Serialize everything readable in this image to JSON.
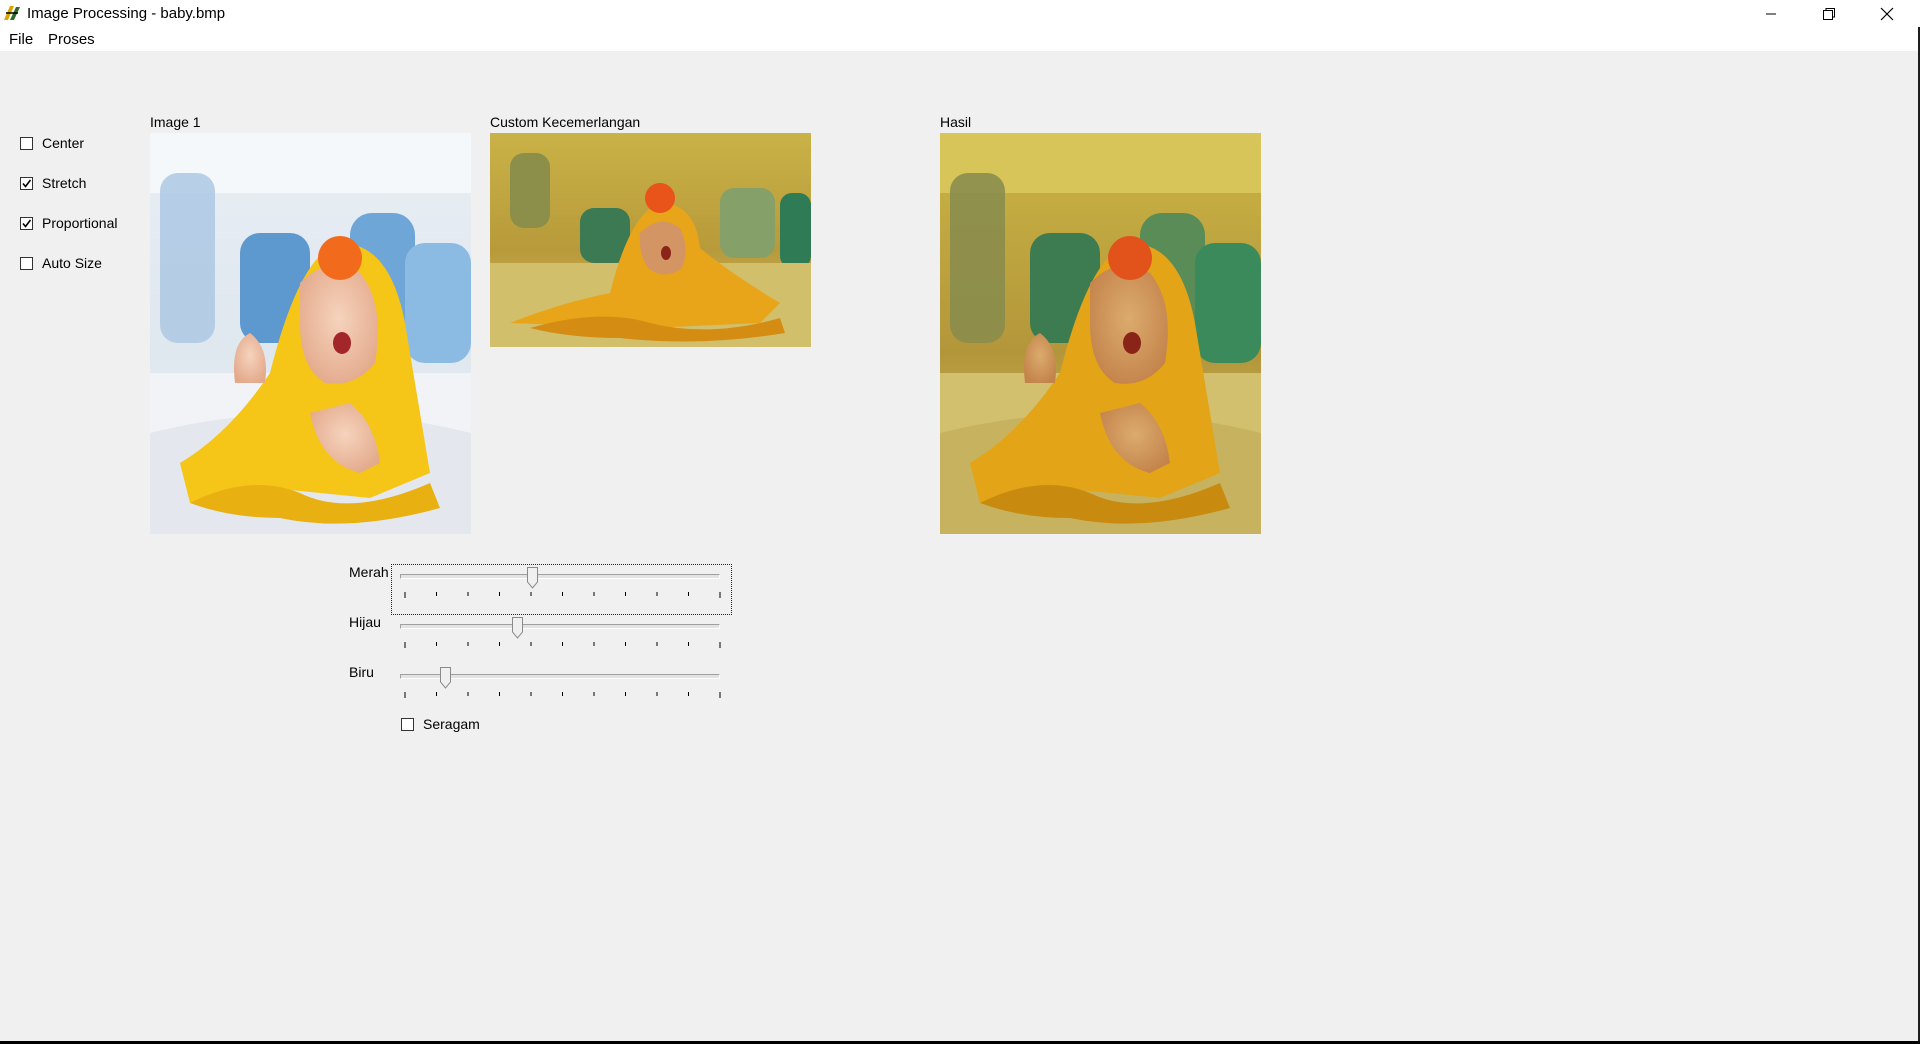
{
  "window": {
    "title": "Image Processing - baby.bmp",
    "icons": {
      "app": "app-icon",
      "minimize": "minimize-icon",
      "restore": "restore-icon",
      "close": "close-icon"
    }
  },
  "menu": {
    "items": [
      "File",
      "Proses"
    ]
  },
  "options": [
    {
      "label": "Center",
      "checked": false
    },
    {
      "label": "Stretch",
      "checked": true
    },
    {
      "label": "Proportional",
      "checked": true
    },
    {
      "label": "Auto Size",
      "checked": false
    }
  ],
  "panels": {
    "image1": {
      "caption": "Image 1"
    },
    "custom": {
      "caption": "Custom Kecemerlangan"
    },
    "result": {
      "caption": "Hasil"
    }
  },
  "sliders": [
    {
      "label": "Merah",
      "value": 0.41
    },
    {
      "label": "Hijau",
      "value": 0.36
    },
    {
      "label": "Biru",
      "value": 0.13
    }
  ],
  "uniform": {
    "label": "Seragam",
    "checked": false
  },
  "colors": {
    "title_bg": "#ffffff",
    "window_bg": "#f0f0f0",
    "towel_yellow": "#f5c518",
    "hat_orange": "#f26b1d"
  }
}
